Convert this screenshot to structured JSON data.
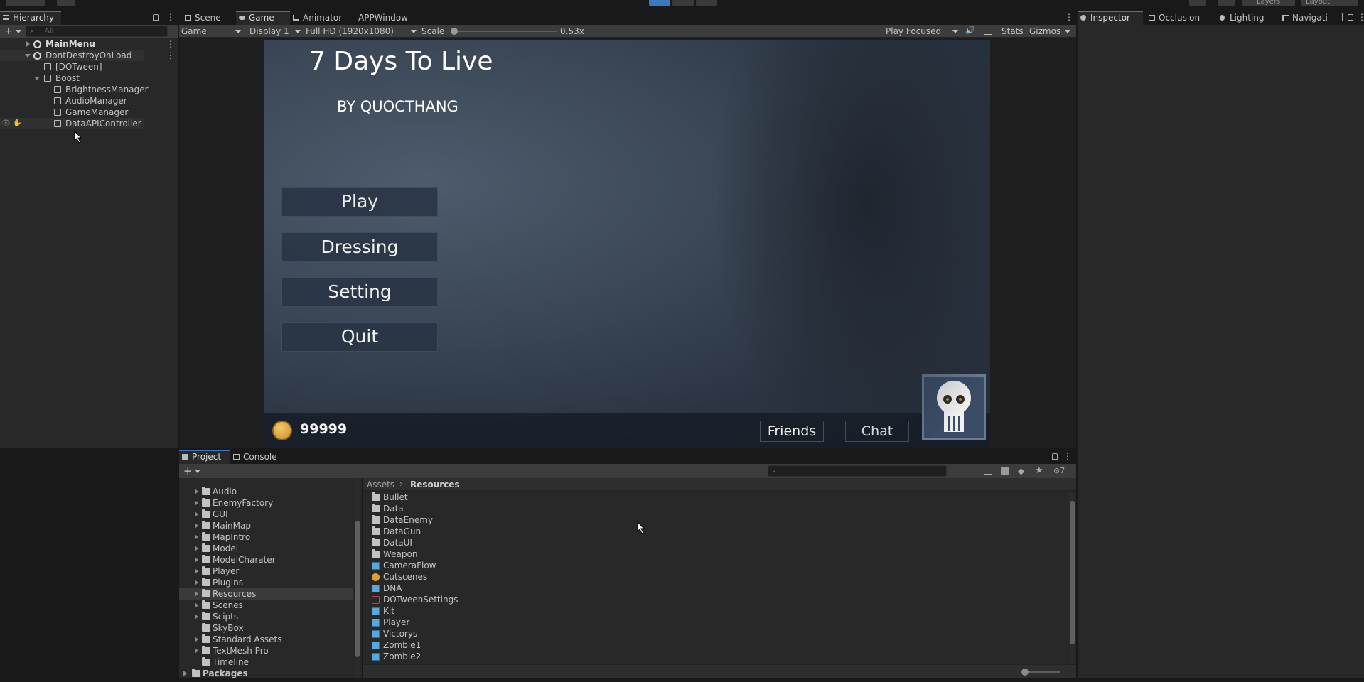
{
  "hierarchy": {
    "tab_label": "Hierarchy",
    "search_placeholder": "All",
    "rows": [
      {
        "label": "MainMenu"
      },
      {
        "label": "DontDestroyOnLoad"
      },
      {
        "label": "[DOTween]"
      },
      {
        "label": "Boost"
      },
      {
        "label": "BrightnessManager"
      },
      {
        "label": "AudioManager"
      },
      {
        "label": "GameManager"
      },
      {
        "label": "DataAPIController"
      }
    ]
  },
  "center_tabs": [
    {
      "label": "Scene",
      "icon": "grid-icon"
    },
    {
      "label": "Game",
      "icon": "gamepad-icon"
    },
    {
      "label": "Animator",
      "icon": "animator-icon"
    },
    {
      "label": "APPWindow",
      "icon": ""
    }
  ],
  "game_toolbar": {
    "view_mode": "Game",
    "display": "Display 1",
    "resolution": "Full HD (1920x1080)",
    "scale_label": "Scale",
    "scale_value": "0.53x",
    "play_mode": "Play Focused",
    "stats": "Stats",
    "gizmos": "Gizmos"
  },
  "game": {
    "title": "7 Days To Live",
    "subtitle": "BY QUOCTHANG",
    "menu": [
      "Play",
      "Dressing",
      "Setting",
      "Quit"
    ],
    "coins": "99999",
    "friends": "Friends",
    "chat": "Chat"
  },
  "right_tabs": [
    {
      "label": "Inspector"
    },
    {
      "label": "Occlusion"
    },
    {
      "label": "Lighting"
    },
    {
      "label": "Navigati"
    }
  ],
  "project": {
    "tabs": [
      "Project",
      "Console"
    ],
    "hidden_count": "7",
    "tree": [
      {
        "label": "Audio"
      },
      {
        "label": "EnemyFactory"
      },
      {
        "label": "GUI"
      },
      {
        "label": "MainMap"
      },
      {
        "label": "MapIntro"
      },
      {
        "label": "Model"
      },
      {
        "label": "ModelCharater"
      },
      {
        "label": "Player"
      },
      {
        "label": "Plugins"
      },
      {
        "label": "Resources"
      },
      {
        "label": "Scenes"
      },
      {
        "label": "Scipts"
      },
      {
        "label": "SkyBox"
      },
      {
        "label": "Standard Assets"
      },
      {
        "label": "TextMesh Pro"
      },
      {
        "label": "Timeline"
      },
      {
        "label": "Packages"
      }
    ],
    "breadcrumb": [
      "Assets",
      "Resources"
    ],
    "items": [
      {
        "label": "Bullet",
        "kind": "folder"
      },
      {
        "label": "Data",
        "kind": "folder"
      },
      {
        "label": "DataEnemy",
        "kind": "folder"
      },
      {
        "label": "DataGun",
        "kind": "folder"
      },
      {
        "label": "DataUI",
        "kind": "folder"
      },
      {
        "label": "Weapon",
        "kind": "folder"
      },
      {
        "label": "CameraFlow",
        "kind": "prefab"
      },
      {
        "label": "Cutscenes",
        "kind": "timeline"
      },
      {
        "label": "DNA",
        "kind": "prefab"
      },
      {
        "label": "DOTweenSettings",
        "kind": "scriptable"
      },
      {
        "label": "Kit",
        "kind": "prefab"
      },
      {
        "label": "Player",
        "kind": "prefab"
      },
      {
        "label": "Victorys",
        "kind": "prefab"
      },
      {
        "label": "Zombie1",
        "kind": "prefab"
      },
      {
        "label": "Zombie2",
        "kind": "prefab"
      }
    ]
  },
  "topbar": {
    "layers": "Layers",
    "layout": "Layout"
  }
}
